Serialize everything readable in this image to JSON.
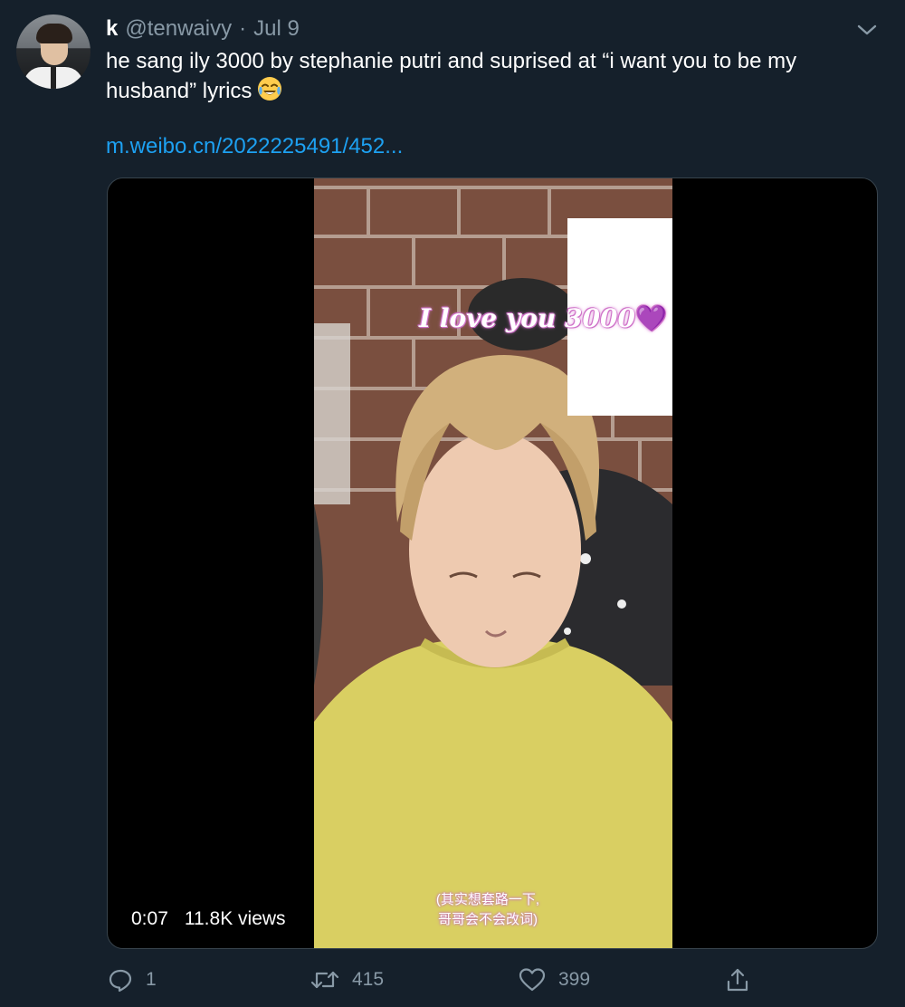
{
  "tweet": {
    "display_name": "k",
    "handle": "@tenwaivy",
    "separator": "·",
    "date": "Jul 9",
    "text": "he sang ily 3000 by stephanie putri and suprised at “i want you to be my husband” lyrics",
    "emoji": "face-with-tears-of-joy",
    "link": "m.weibo.cn/2022225491/452..."
  },
  "video": {
    "overlay_title": "I love you 3000",
    "overlay_heart": "💜",
    "subtitle_line1": "(其实想套路一下,",
    "subtitle_line2": "哥哥会不会改词)",
    "time": "0:07",
    "views": "11.8K views"
  },
  "actions": {
    "reply_count": "1",
    "retweet_count": "415",
    "like_count": "399"
  },
  "colors": {
    "background": "#15202b",
    "secondary_text": "#8899a6",
    "link": "#1da1f2",
    "border": "#38444d"
  }
}
